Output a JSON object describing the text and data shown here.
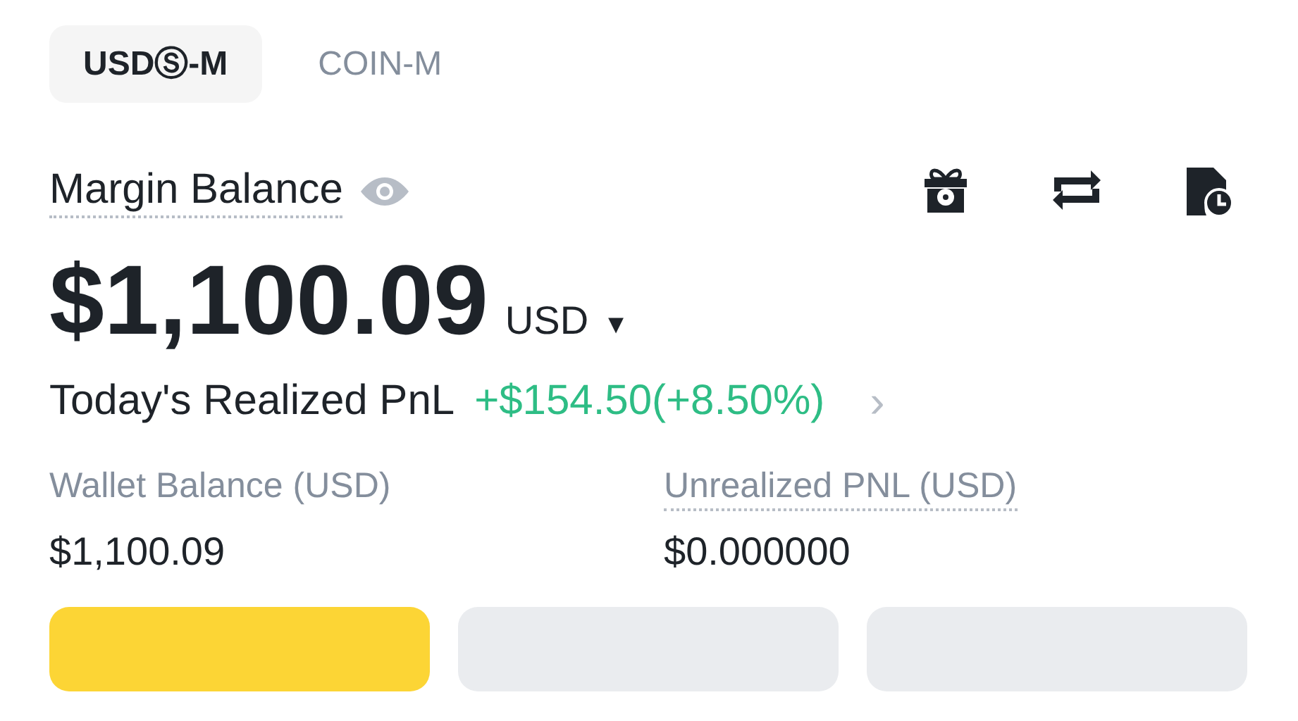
{
  "tabs": [
    {
      "label": "USDⓈ-M",
      "selected": true
    },
    {
      "label": "COIN-M",
      "selected": false
    }
  ],
  "balance": {
    "label": "Margin Balance",
    "amount": "$1,100.09",
    "currency": "USD",
    "caret": "▾"
  },
  "pnl": {
    "label": "Today's Realized PnL",
    "value": "+$154.50(+8.50%)",
    "chevron": "›"
  },
  "stats": [
    {
      "label": "Wallet Balance (USD)",
      "value": "$1,100.09",
      "dotted": false
    },
    {
      "label": "Unrealized PNL (USD)",
      "value": "$0.000000",
      "dotted": true
    }
  ],
  "buttons": [
    {
      "kind": "primary"
    },
    {
      "kind": "secondary"
    },
    {
      "kind": "secondary"
    }
  ]
}
